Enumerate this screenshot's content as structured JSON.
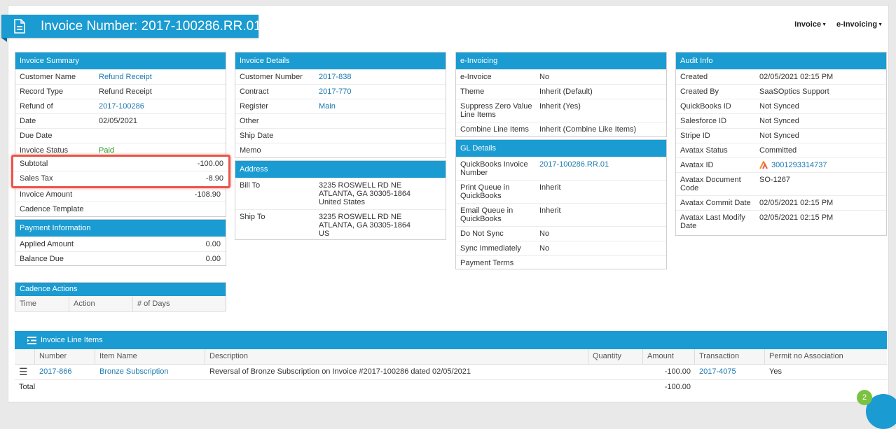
{
  "header": {
    "title": "Invoice Number: 2017-100286.RR.01",
    "menu": [
      {
        "label": "Invoice"
      },
      {
        "label": "e-Invoicing"
      }
    ]
  },
  "invoice_summary": {
    "title": "Invoice Summary",
    "rows": [
      {
        "label": "Customer Name",
        "value": "Refund Receipt",
        "link": true
      },
      {
        "label": "Record Type",
        "value": "Refund Receipt"
      },
      {
        "label": "Refund of",
        "value": "2017-100286",
        "link": true
      },
      {
        "label": "Date",
        "value": "02/05/2021"
      },
      {
        "label": "Due Date",
        "value": ""
      },
      {
        "label": "Invoice Status",
        "value": "Paid",
        "status": true
      }
    ],
    "highlighted_rows": [
      {
        "label": "Subtotal",
        "value": "-100.00"
      },
      {
        "label": "Sales Tax",
        "value": "-8.90"
      }
    ],
    "after_rows": [
      {
        "label": "Invoice Amount",
        "value": "-108.90"
      },
      {
        "label": "Cadence Template",
        "value": ""
      }
    ]
  },
  "payment_information": {
    "title": "Payment Information",
    "rows": [
      {
        "label": "Applied Amount",
        "value": "0.00"
      },
      {
        "label": "Balance Due",
        "value": "0.00"
      }
    ]
  },
  "cadence_actions": {
    "title": "Cadence Actions",
    "columns": [
      "Time",
      "Action",
      "# of Days"
    ]
  },
  "invoice_details": {
    "title": "Invoice Details",
    "rows": [
      {
        "label": "Customer Number",
        "value": "2017-838",
        "link": true
      },
      {
        "label": "Contract",
        "value": "2017-770",
        "link": true
      },
      {
        "label": "Register",
        "value": "Main",
        "link": true
      },
      {
        "label": "Other",
        "value": ""
      },
      {
        "label": "Ship Date",
        "value": ""
      },
      {
        "label": "Memo",
        "value": ""
      }
    ]
  },
  "address": {
    "title": "Address",
    "rows": [
      {
        "label": "Bill To",
        "lines": [
          "3235 ROSWELL RD NE",
          "ATLANTA, GA 30305-1864",
          "United States"
        ]
      },
      {
        "label": "Ship To",
        "lines": [
          "3235 ROSWELL RD NE",
          "ATLANTA, GA 30305-1864",
          "US"
        ]
      }
    ]
  },
  "e_invoicing": {
    "title": "e-Invoicing",
    "rows": [
      {
        "label": "e-Invoice",
        "value": "No"
      },
      {
        "label": "Theme",
        "value": "Inherit (Default)"
      },
      {
        "label": "Suppress Zero Value Line Items",
        "value": "Inherit (Yes)"
      },
      {
        "label": "Combine Line Items",
        "value": "Inherit (Combine Like Items)"
      }
    ]
  },
  "gl_details": {
    "title": "GL Details",
    "rows": [
      {
        "label": "QuickBooks Invoice Number",
        "value": "2017-100286.RR.01",
        "link": true
      },
      {
        "label": "Print Queue in QuickBooks",
        "value": "Inherit"
      },
      {
        "label": "Email Queue in QuickBooks",
        "value": "Inherit"
      },
      {
        "label": "Do Not Sync",
        "value": "No"
      },
      {
        "label": "Sync Immediately",
        "value": "No"
      },
      {
        "label": "Payment Terms",
        "value": ""
      }
    ]
  },
  "audit_info": {
    "title": "Audit Info",
    "rows": [
      {
        "label": "Created",
        "value": "02/05/2021 02:15 PM"
      },
      {
        "label": "Created By",
        "value": "SaaSOptics Support"
      },
      {
        "label": "QuickBooks ID",
        "value": "Not Synced"
      },
      {
        "label": "Salesforce ID",
        "value": "Not Synced"
      },
      {
        "label": "Stripe ID",
        "value": "Not Synced"
      },
      {
        "label": "Avatax Status",
        "value": "Committed"
      },
      {
        "label": "Avatax ID",
        "value": "3001293314737",
        "link": true,
        "icon": "avatax-logo-icon"
      },
      {
        "label": "Avatax Document Code",
        "value": "SO-1267"
      },
      {
        "label": "Avatax Commit Date",
        "value": "02/05/2021 02:15 PM"
      },
      {
        "label": "Avatax Last Modify Date",
        "value": "02/05/2021 02:15 PM"
      }
    ]
  },
  "line_items": {
    "title": "Invoice Line Items",
    "columns": [
      "Number",
      "Item Name",
      "Description",
      "Quantity",
      "Amount",
      "Transaction",
      "Permit no Association"
    ],
    "rows": [
      {
        "number": "2017-866",
        "item_name": "Bronze Subscription",
        "description": "Reversal of Bronze Subscription on Invoice #2017-100286 dated 02/05/2021",
        "quantity": "",
        "amount": "-100.00",
        "transaction": "2017-4075",
        "permit": "Yes"
      }
    ],
    "total_label": "Total",
    "total_amount": "-100.00"
  },
  "chat": {
    "badge_count": "2"
  },
  "colors": {
    "accent": "#1a9bd1",
    "link": "#1a78b0",
    "status_paid": "#1e9a1e",
    "highlight": "#e8564b"
  }
}
